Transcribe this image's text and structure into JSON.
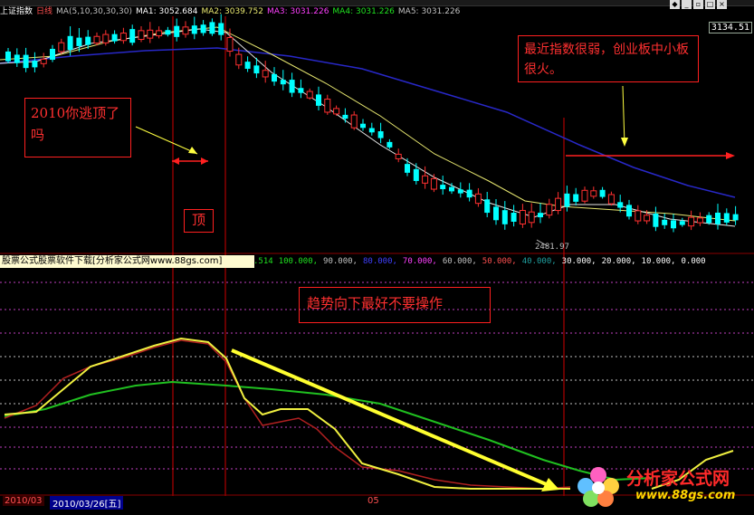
{
  "app": {
    "index_name": "上证指数",
    "period": "日线"
  },
  "ma_bar": {
    "params": "MA(5,10,30,30,30)",
    "ma1": "MA1: 3052.684",
    "ma2": "MA2: 3039.752",
    "ma3": "MA3: 3031.226",
    "ma4": "MA4: 3031.226",
    "ma5": "MA5: 3031.226"
  },
  "price_label": "3134.51",
  "low_label": "2481.97",
  "notes": {
    "escape_top": "2010你逃顶了吗",
    "weak_index": "最近指数很弱，创业板中小板很火。",
    "trend_down": "趋势向下最好不要操作",
    "top": "顶"
  },
  "sub_banner": "股票公式股票软件下载[分析家公式网www.88gs.com]",
  "sub_scale": {
    "s0": ".514",
    "s1": "100.000,",
    "s2": "90.000,",
    "s3": "80.000,",
    "s4": "70.000,",
    "s5": "60.000,",
    "s6": "50.000,",
    "s7": "40.000,",
    "s8": "30.000,",
    "s9": "20.000,",
    "s10": "10.000,",
    "s11": "0.000"
  },
  "dates": {
    "d1": "2010/03",
    "d2": "2010/03/26[五]",
    "tick": "05"
  },
  "logo": {
    "name": "分析家公式网",
    "url": "www.88gs.com"
  },
  "colors": {
    "up": "#ff3030",
    "down": "#00ffff",
    "ma_yellow": "#e8e870",
    "ma_white": "#e0e0e0",
    "ma_blue": "#2020c0",
    "green": "#20c020"
  }
}
